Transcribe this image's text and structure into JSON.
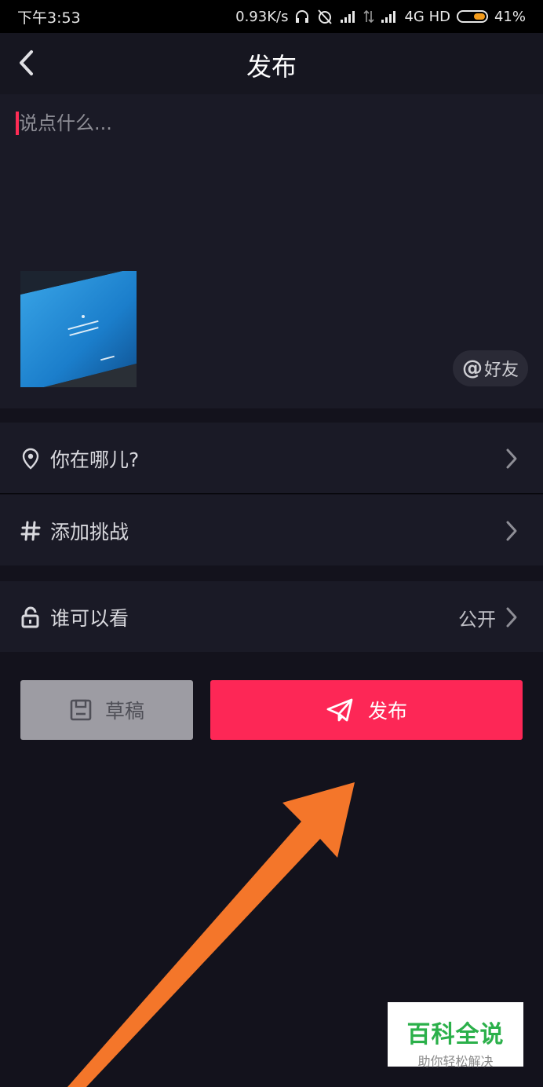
{
  "status_bar": {
    "time": "下午3:53",
    "speed": "0.93K/s",
    "network": "4G HD",
    "battery": "41%",
    "battery_level": 0.41
  },
  "nav": {
    "title": "发布",
    "back_icon": "chevron-left-icon"
  },
  "compose": {
    "placeholder": "说点什么...",
    "value": "",
    "mention_label": "好友",
    "mention_symbol": "@"
  },
  "options": {
    "location_label": "你在哪儿?",
    "challenge_label": "添加挑战",
    "visibility_label": "谁可以看",
    "visibility_value": "公开"
  },
  "actions": {
    "draft_label": "草稿",
    "publish_label": "发布"
  },
  "watermark": {
    "title": "百科全说",
    "subtitle": "助你轻松解决"
  },
  "colors": {
    "accent": "#fd2756",
    "annotation_arrow": "#f4762a",
    "watermark_green": "#2bb04a"
  }
}
